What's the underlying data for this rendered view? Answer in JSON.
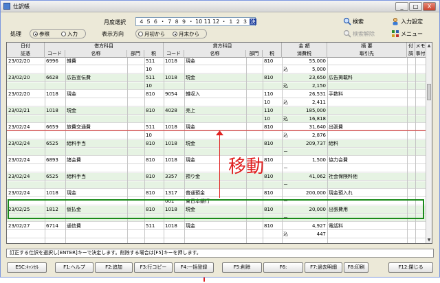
{
  "window": {
    "title": "仕訳帳",
    "min_label": "_",
    "max_label": "□",
    "close_label": "X"
  },
  "controls": {
    "month_label": "月度選択",
    "month_value_prefix": "４ ５ ６ ・ ７ ８ ９ ・ 10 11 12 ・ １ ２ ３ ",
    "month_selected": "決",
    "mode_label": "処理",
    "mode_options": [
      "参照",
      "入力"
    ],
    "direction_label": "表示方向",
    "direction_options": [
      "月初から",
      "月末から"
    ],
    "search_label": "検索",
    "search_clear_label": "検索解除",
    "input_settings_label": "入力設定",
    "menu_label": "メニュー"
  },
  "table": {
    "headers": {
      "date": "日付",
      "voucher": "証憑",
      "debit_group": "借方科目",
      "credit_group": "貸方科目",
      "code": "コード",
      "name": "名称",
      "dept": "部門",
      "tax": "税",
      "amount": "金 額",
      "tax_amount": "消費税",
      "summary": "摘 要",
      "partner": "取引先",
      "attach": "付",
      "attach2": "調",
      "memo": "メモ",
      "memo2": "事",
      "memo3": "付"
    },
    "rows": [
      {
        "g": false,
        "date": "23/02/20",
        "dcode": "6996",
        "dname": "雑費",
        "dtax": "511",
        "ccode": "1018",
        "cname": "現金",
        "ctax": "810",
        "flag": "",
        "amount": "55,000",
        "summary": ""
      },
      {
        "g": false,
        "date": "",
        "dcode": "",
        "dname": "",
        "dtax": "10",
        "ccode": "",
        "cname": "",
        "ctax": "",
        "flag": "込",
        "amount": "5,000",
        "summary": ""
      },
      {
        "g": true,
        "date": "23/02/20",
        "dcode": "6628",
        "dname": "広告宣伝費",
        "dtax": "511",
        "ccode": "1018",
        "cname": "現金",
        "ctax": "810",
        "flag": "",
        "amount": "23,650",
        "summary": "広告掲載料"
      },
      {
        "g": true,
        "date": "",
        "dcode": "",
        "dname": "",
        "dtax": "10",
        "ccode": "",
        "cname": "",
        "ctax": "",
        "flag": "込",
        "amount": "2,150",
        "summary": ""
      },
      {
        "g": false,
        "date": "23/02/20",
        "dcode": "1018",
        "dname": "現金",
        "dtax": "810",
        "ccode": "9054",
        "cname": "雑収入",
        "ctax": "110",
        "flag": "",
        "amount": "26,531",
        "summary": "手数料"
      },
      {
        "g": false,
        "date": "",
        "dcode": "",
        "dname": "",
        "dtax": "",
        "ccode": "",
        "cname": "",
        "ctax": "10",
        "flag": "込",
        "amount": "2,411",
        "summary": ""
      },
      {
        "g": true,
        "date": "23/02/21",
        "dcode": "1018",
        "dname": "現金",
        "dtax": "810",
        "ccode": "4028",
        "cname": "売上",
        "ctax": "110",
        "flag": "",
        "amount": "185,000",
        "summary": ""
      },
      {
        "g": true,
        "date": "",
        "dcode": "",
        "dname": "",
        "dtax": "",
        "ccode": "",
        "cname": "",
        "ctax": "10",
        "flag": "込",
        "amount": "16,818",
        "summary": ""
      },
      {
        "g": false,
        "date": "23/02/24",
        "dcode": "6659",
        "dname": "旅費交通費",
        "dtax": "511",
        "ccode": "1018",
        "cname": "現金",
        "ctax": "810",
        "flag": "",
        "amount": "31,640",
        "summary": "出張費"
      },
      {
        "g": false,
        "date": "",
        "dcode": "",
        "dname": "",
        "dtax": "10",
        "ccode": "",
        "cname": "",
        "ctax": "",
        "flag": "込",
        "amount": "2,876",
        "summary": ""
      },
      {
        "g": true,
        "date": "23/02/24",
        "dcode": "6525",
        "dname": "給料手当",
        "dtax": "810",
        "ccode": "1018",
        "cname": "現金",
        "ctax": "810",
        "flag": "",
        "amount": "209,737",
        "summary": "給料"
      },
      {
        "g": true,
        "date": "",
        "dcode": "",
        "dname": "",
        "dtax": "",
        "ccode": "",
        "cname": "",
        "ctax": "",
        "flag": "－",
        "amount": "",
        "summary": ""
      },
      {
        "g": false,
        "date": "23/02/24",
        "dcode": "6893",
        "dname": "諸会費",
        "dtax": "810",
        "ccode": "1018",
        "cname": "現金",
        "ctax": "810",
        "flag": "",
        "amount": "1,500",
        "summary": "協力会費"
      },
      {
        "g": false,
        "date": "",
        "dcode": "",
        "dname": "",
        "dtax": "",
        "ccode": "",
        "cname": "",
        "ctax": "",
        "flag": "－",
        "amount": "",
        "summary": ""
      },
      {
        "g": true,
        "date": "23/02/24",
        "dcode": "6525",
        "dname": "給料手当",
        "dtax": "810",
        "ccode": "3357",
        "cname": "預り金",
        "ctax": "810",
        "flag": "",
        "amount": "41,062",
        "summary": "社会保険料他"
      },
      {
        "g": true,
        "date": "",
        "dcode": "",
        "dname": "",
        "dtax": "",
        "ccode": "",
        "cname": "",
        "ctax": "",
        "flag": "－",
        "amount": "",
        "summary": ""
      },
      {
        "g": false,
        "date": "23/02/24",
        "dcode": "1018",
        "dname": "現金",
        "dtax": "810",
        "ccode": "1317",
        "cname": "普通預金",
        "ctax": "810",
        "flag": "",
        "amount": "200,000",
        "summary": "現金預入れ"
      },
      {
        "g": false,
        "date": "",
        "dcode": "",
        "dname": "",
        "dtax": "",
        "ccode": "001",
        "cname": "東日本銀行",
        "ctax": "",
        "flag": "－",
        "amount": "",
        "summary": ""
      },
      {
        "g": true,
        "date": "23/02/25",
        "dcode": "1812",
        "dname": "仮払金",
        "dtax": "810",
        "ccode": "1018",
        "cname": "現金",
        "ctax": "810",
        "flag": "",
        "amount": "20,000",
        "summary": "出張費用"
      },
      {
        "g": true,
        "date": "",
        "dcode": "",
        "dname": "",
        "dtax": "",
        "ccode": "",
        "cname": "",
        "ctax": "",
        "flag": "－",
        "amount": "",
        "summary": ""
      },
      {
        "g": false,
        "date": "23/02/27",
        "dcode": "6714",
        "dname": "通信費",
        "dtax": "511",
        "ccode": "1018",
        "cname": "現金",
        "ctax": "810",
        "flag": "",
        "amount": "4,927",
        "summary": "電話料"
      },
      {
        "g": false,
        "date": "",
        "dcode": "",
        "dname": "",
        "dtax": "",
        "ccode": "",
        "cname": "",
        "ctax": "",
        "flag": "込",
        "amount": "447",
        "summary": ""
      }
    ]
  },
  "annotation": {
    "text": "移動"
  },
  "status_text": "訂正する仕訳を選択し[ENTER]キーで決定します。削除する場合は[F5]キーを押します。",
  "fkeys": [
    "ESC:ｷｬﾝｾﾙ",
    "F1:ヘルプ",
    "F2:追加",
    "F3:行コピー",
    "F4:一括登録",
    "F5:削除",
    "F6:",
    "F7:過去明細",
    "F8:印刷",
    "F12:閉じる"
  ],
  "colors": {
    "accent_red": "#e02020",
    "highlight_green": "#1a8a1a",
    "row_green": "#e6f3e3"
  }
}
